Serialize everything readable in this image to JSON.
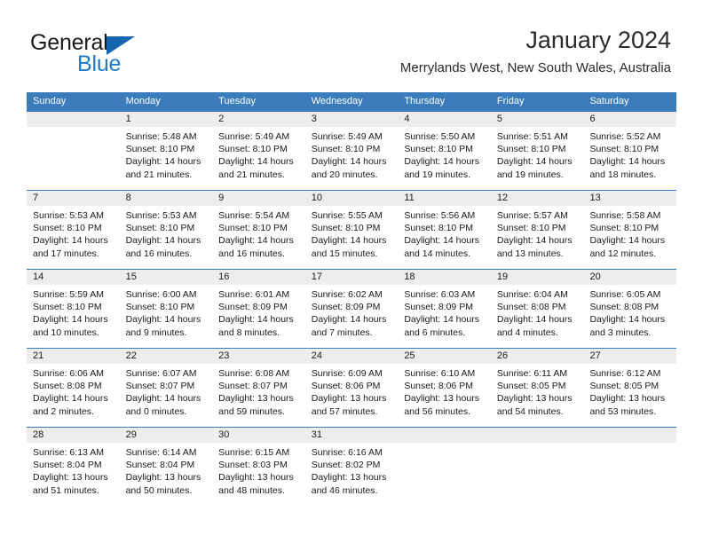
{
  "brand": {
    "name_part1": "General",
    "name_part2": "Blue",
    "triangle_icon": "triangle-icon",
    "colors": {
      "dark": "#1a1a1a",
      "blue": "#1f7bc4",
      "triangle": "#1565b0"
    }
  },
  "header": {
    "title": "January 2024",
    "location": "Merrylands West, New South Wales, Australia"
  },
  "theme": {
    "header_bar": "#3b7cbd",
    "day_number_band": "#ededed",
    "text": "#1a1a1a",
    "page_background": "#ffffff"
  },
  "weekday_headers": [
    "Sunday",
    "Monday",
    "Tuesday",
    "Wednesday",
    "Thursday",
    "Friday",
    "Saturday"
  ],
  "labels": {
    "sunrise": "Sunrise:",
    "sunset": "Sunset:",
    "daylight": "Daylight:"
  },
  "weeks": [
    [
      {
        "day": "",
        "sunrise": "",
        "sunset": "",
        "daylight_line1": "",
        "daylight_line2": "",
        "empty": true
      },
      {
        "day": "1",
        "sunrise": "Sunrise: 5:48 AM",
        "sunset": "Sunset: 8:10 PM",
        "daylight_line1": "Daylight: 14 hours",
        "daylight_line2": "and 21 minutes."
      },
      {
        "day": "2",
        "sunrise": "Sunrise: 5:49 AM",
        "sunset": "Sunset: 8:10 PM",
        "daylight_line1": "Daylight: 14 hours",
        "daylight_line2": "and 21 minutes."
      },
      {
        "day": "3",
        "sunrise": "Sunrise: 5:49 AM",
        "sunset": "Sunset: 8:10 PM",
        "daylight_line1": "Daylight: 14 hours",
        "daylight_line2": "and 20 minutes."
      },
      {
        "day": "4",
        "sunrise": "Sunrise: 5:50 AM",
        "sunset": "Sunset: 8:10 PM",
        "daylight_line1": "Daylight: 14 hours",
        "daylight_line2": "and 19 minutes."
      },
      {
        "day": "5",
        "sunrise": "Sunrise: 5:51 AM",
        "sunset": "Sunset: 8:10 PM",
        "daylight_line1": "Daylight: 14 hours",
        "daylight_line2": "and 19 minutes."
      },
      {
        "day": "6",
        "sunrise": "Sunrise: 5:52 AM",
        "sunset": "Sunset: 8:10 PM",
        "daylight_line1": "Daylight: 14 hours",
        "daylight_line2": "and 18 minutes."
      }
    ],
    [
      {
        "day": "7",
        "sunrise": "Sunrise: 5:53 AM",
        "sunset": "Sunset: 8:10 PM",
        "daylight_line1": "Daylight: 14 hours",
        "daylight_line2": "and 17 minutes."
      },
      {
        "day": "8",
        "sunrise": "Sunrise: 5:53 AM",
        "sunset": "Sunset: 8:10 PM",
        "daylight_line1": "Daylight: 14 hours",
        "daylight_line2": "and 16 minutes."
      },
      {
        "day": "9",
        "sunrise": "Sunrise: 5:54 AM",
        "sunset": "Sunset: 8:10 PM",
        "daylight_line1": "Daylight: 14 hours",
        "daylight_line2": "and 16 minutes."
      },
      {
        "day": "10",
        "sunrise": "Sunrise: 5:55 AM",
        "sunset": "Sunset: 8:10 PM",
        "daylight_line1": "Daylight: 14 hours",
        "daylight_line2": "and 15 minutes."
      },
      {
        "day": "11",
        "sunrise": "Sunrise: 5:56 AM",
        "sunset": "Sunset: 8:10 PM",
        "daylight_line1": "Daylight: 14 hours",
        "daylight_line2": "and 14 minutes."
      },
      {
        "day": "12",
        "sunrise": "Sunrise: 5:57 AM",
        "sunset": "Sunset: 8:10 PM",
        "daylight_line1": "Daylight: 14 hours",
        "daylight_line2": "and 13 minutes."
      },
      {
        "day": "13",
        "sunrise": "Sunrise: 5:58 AM",
        "sunset": "Sunset: 8:10 PM",
        "daylight_line1": "Daylight: 14 hours",
        "daylight_line2": "and 12 minutes."
      }
    ],
    [
      {
        "day": "14",
        "sunrise": "Sunrise: 5:59 AM",
        "sunset": "Sunset: 8:10 PM",
        "daylight_line1": "Daylight: 14 hours",
        "daylight_line2": "and 10 minutes."
      },
      {
        "day": "15",
        "sunrise": "Sunrise: 6:00 AM",
        "sunset": "Sunset: 8:10 PM",
        "daylight_line1": "Daylight: 14 hours",
        "daylight_line2": "and 9 minutes."
      },
      {
        "day": "16",
        "sunrise": "Sunrise: 6:01 AM",
        "sunset": "Sunset: 8:09 PM",
        "daylight_line1": "Daylight: 14 hours",
        "daylight_line2": "and 8 minutes."
      },
      {
        "day": "17",
        "sunrise": "Sunrise: 6:02 AM",
        "sunset": "Sunset: 8:09 PM",
        "daylight_line1": "Daylight: 14 hours",
        "daylight_line2": "and 7 minutes."
      },
      {
        "day": "18",
        "sunrise": "Sunrise: 6:03 AM",
        "sunset": "Sunset: 8:09 PM",
        "daylight_line1": "Daylight: 14 hours",
        "daylight_line2": "and 6 minutes."
      },
      {
        "day": "19",
        "sunrise": "Sunrise: 6:04 AM",
        "sunset": "Sunset: 8:08 PM",
        "daylight_line1": "Daylight: 14 hours",
        "daylight_line2": "and 4 minutes."
      },
      {
        "day": "20",
        "sunrise": "Sunrise: 6:05 AM",
        "sunset": "Sunset: 8:08 PM",
        "daylight_line1": "Daylight: 14 hours",
        "daylight_line2": "and 3 minutes."
      }
    ],
    [
      {
        "day": "21",
        "sunrise": "Sunrise: 6:06 AM",
        "sunset": "Sunset: 8:08 PM",
        "daylight_line1": "Daylight: 14 hours",
        "daylight_line2": "and 2 minutes."
      },
      {
        "day": "22",
        "sunrise": "Sunrise: 6:07 AM",
        "sunset": "Sunset: 8:07 PM",
        "daylight_line1": "Daylight: 14 hours",
        "daylight_line2": "and 0 minutes."
      },
      {
        "day": "23",
        "sunrise": "Sunrise: 6:08 AM",
        "sunset": "Sunset: 8:07 PM",
        "daylight_line1": "Daylight: 13 hours",
        "daylight_line2": "and 59 minutes."
      },
      {
        "day": "24",
        "sunrise": "Sunrise: 6:09 AM",
        "sunset": "Sunset: 8:06 PM",
        "daylight_line1": "Daylight: 13 hours",
        "daylight_line2": "and 57 minutes."
      },
      {
        "day": "25",
        "sunrise": "Sunrise: 6:10 AM",
        "sunset": "Sunset: 8:06 PM",
        "daylight_line1": "Daylight: 13 hours",
        "daylight_line2": "and 56 minutes."
      },
      {
        "day": "26",
        "sunrise": "Sunrise: 6:11 AM",
        "sunset": "Sunset: 8:05 PM",
        "daylight_line1": "Daylight: 13 hours",
        "daylight_line2": "and 54 minutes."
      },
      {
        "day": "27",
        "sunrise": "Sunrise: 6:12 AM",
        "sunset": "Sunset: 8:05 PM",
        "daylight_line1": "Daylight: 13 hours",
        "daylight_line2": "and 53 minutes."
      }
    ],
    [
      {
        "day": "28",
        "sunrise": "Sunrise: 6:13 AM",
        "sunset": "Sunset: 8:04 PM",
        "daylight_line1": "Daylight: 13 hours",
        "daylight_line2": "and 51 minutes."
      },
      {
        "day": "29",
        "sunrise": "Sunrise: 6:14 AM",
        "sunset": "Sunset: 8:04 PM",
        "daylight_line1": "Daylight: 13 hours",
        "daylight_line2": "and 50 minutes."
      },
      {
        "day": "30",
        "sunrise": "Sunrise: 6:15 AM",
        "sunset": "Sunset: 8:03 PM",
        "daylight_line1": "Daylight: 13 hours",
        "daylight_line2": "and 48 minutes."
      },
      {
        "day": "31",
        "sunrise": "Sunrise: 6:16 AM",
        "sunset": "Sunset: 8:02 PM",
        "daylight_line1": "Daylight: 13 hours",
        "daylight_line2": "and 46 minutes."
      },
      {
        "day": "",
        "sunrise": "",
        "sunset": "",
        "daylight_line1": "",
        "daylight_line2": "",
        "empty": true
      },
      {
        "day": "",
        "sunrise": "",
        "sunset": "",
        "daylight_line1": "",
        "daylight_line2": "",
        "empty": true
      },
      {
        "day": "",
        "sunrise": "",
        "sunset": "",
        "daylight_line1": "",
        "daylight_line2": "",
        "empty": true
      }
    ]
  ]
}
